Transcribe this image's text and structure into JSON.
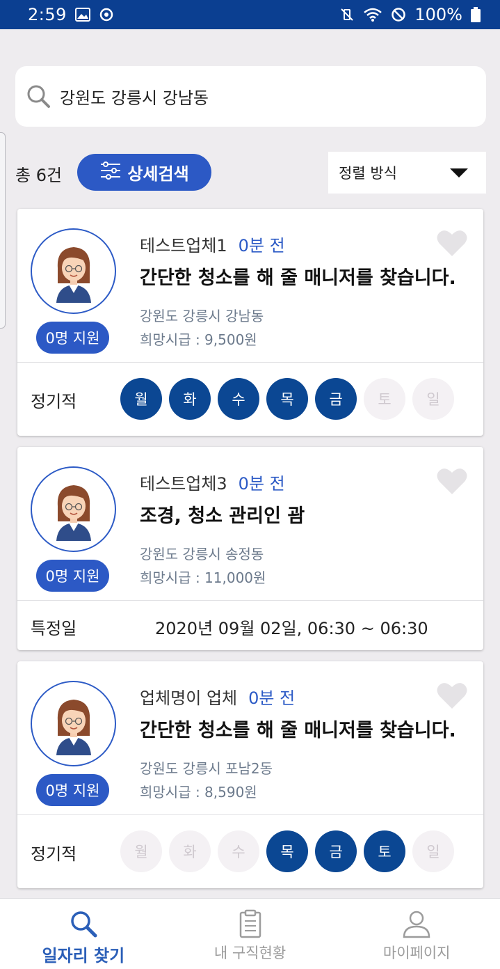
{
  "status_bar": {
    "time": "2:59",
    "battery": "100%",
    "left_icons": [
      "image-icon",
      "sync-icon"
    ],
    "right_icons": [
      "mute-vibrate-icon",
      "wifi-icon",
      "block-icon",
      "battery-icon"
    ],
    "background": "#0b3f91"
  },
  "search": {
    "value": "강원도 강릉시 강남동"
  },
  "filter": {
    "total": "총 6건",
    "detail_label": "상세검색",
    "sort_label": "정렬 방식"
  },
  "cards": [
    {
      "company": "테스트업체1",
      "time_ago": "0분 전",
      "title": "간단한 청소를 해 줄 매니저를 찾습니다.",
      "address": "강원도 강릉시 강남동",
      "wage": "희망시급 : 9,500원",
      "applicants": "0명 지원",
      "schedule_type": "정기적",
      "days": [
        {
          "label": "월",
          "active": true
        },
        {
          "label": "화",
          "active": true
        },
        {
          "label": "수",
          "active": true
        },
        {
          "label": "목",
          "active": true
        },
        {
          "label": "금",
          "active": true
        },
        {
          "label": "토",
          "active": false
        },
        {
          "label": "일",
          "active": false
        }
      ]
    },
    {
      "company": "테스트업체3",
      "time_ago": "0분 전",
      "title": "조경, 청소 관리인 괌",
      "address": "강원도 강릉시 송정동",
      "wage": "희망시급 : 11,000원",
      "applicants": "0명 지원",
      "schedule_type": "특정일",
      "date": "2020년 09월 02일, 06:30 ~ 06:30"
    },
    {
      "company": "업체명이 업체",
      "time_ago": "0분 전",
      "title": "간단한 청소를 해 줄 매니저를 찾습니다.",
      "address": "강원도 강릉시 포남2동",
      "wage": "희망시급 : 8,590원",
      "applicants": "0명 지원",
      "schedule_type": "정기적",
      "days": [
        {
          "label": "월",
          "active": false
        },
        {
          "label": "화",
          "active": false
        },
        {
          "label": "수",
          "active": false
        },
        {
          "label": "목",
          "active": true
        },
        {
          "label": "금",
          "active": true
        },
        {
          "label": "토",
          "active": true
        },
        {
          "label": "일",
          "active": false
        }
      ]
    }
  ],
  "bottom_nav": [
    {
      "label": "일자리 찾기",
      "icon": "search-icon",
      "active": true
    },
    {
      "label": "내 구직현황",
      "icon": "clipboard-icon",
      "active": false
    },
    {
      "label": "마이페이지",
      "icon": "person-icon",
      "active": false
    }
  ],
  "colors": {
    "primary": "#2c59c5",
    "day_active": "#0b4793",
    "day_inactive": "#f4f1f4",
    "nav_active": "#2b5fb8"
  }
}
